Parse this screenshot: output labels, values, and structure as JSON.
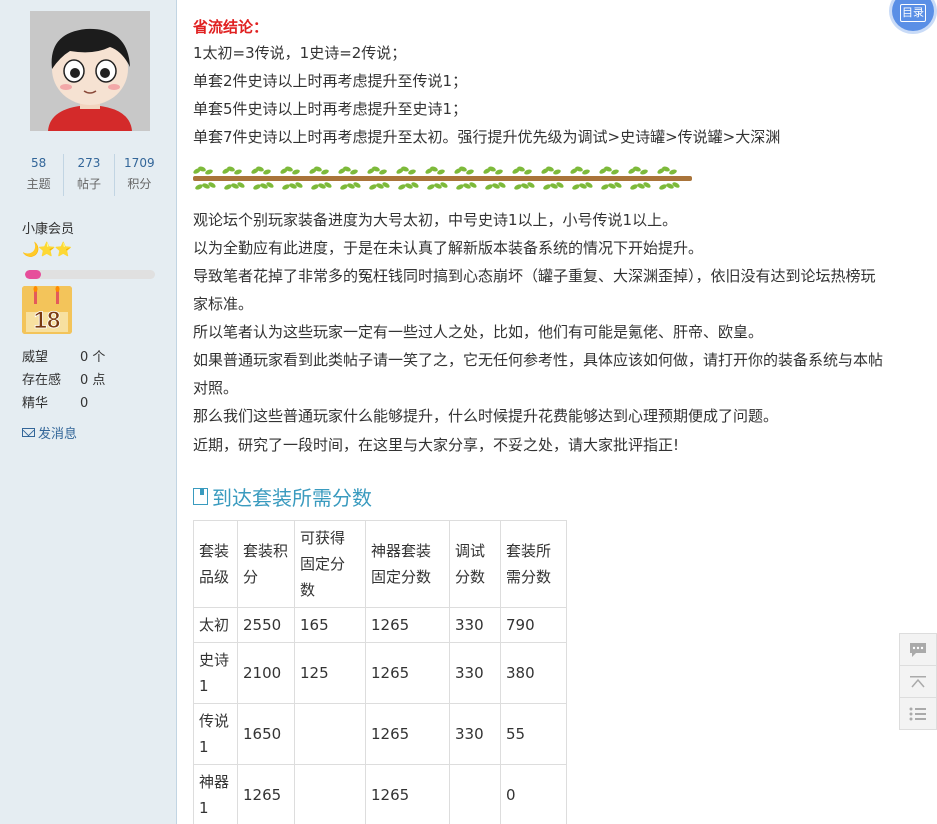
{
  "user": {
    "stats": [
      {
        "num": "58",
        "label": "主题"
      },
      {
        "num": "273",
        "label": "帖子"
      },
      {
        "num": "1709",
        "label": "积分"
      }
    ],
    "group": "小康会员",
    "stars": "🌙⭐⭐",
    "level_progress": 0.12,
    "medal_text": "18",
    "info": [
      {
        "key": "威望",
        "value": "0 个"
      },
      {
        "key": "存在感",
        "value": "0 点"
      },
      {
        "key": "精华",
        "value": "0"
      }
    ],
    "pm_label": "发消息"
  },
  "post": {
    "conclusion_title": "省流结论：",
    "conclusion_lines": [
      "1太初=3传说，1史诗=2传说；",
      "单套2件史诗以上时再考虑提升至传说1；",
      "单套5件史诗以上时再考虑提升至史诗1；",
      "单套7件史诗以上时再考虑提升至太初。强行提升优先级为调试>史诗罐>传说罐>大深渊"
    ],
    "body_lines": [
      "观论坛个别玩家装备进度为大号太初，中号史诗1以上，小号传说1以上。",
      "以为全勤应有此进度，于是在未认真了解新版本装备系统的情况下开始提升。",
      "导致笔者花掉了非常多的冤枉钱同时搞到心态崩坏（罐子重复、大深渊歪掉），依旧没有达到论坛热榜玩",
      "家标准。",
      "所以笔者认为这些玩家一定有一些过人之处，比如，他们有可能是氪佬、肝帝、欧皇。",
      "如果普通玩家看到此类帖子请一笑了之，它无任何参考性，具体应该如何做，请打开你的装备系统与本帖",
      "对照。",
      "那么我们这些普通玩家什么能够提升，什么时候提升花费能够达到心理预期便成了问题。",
      "近期，研究了一段时间，在这里与大家分享，不妥之处，请大家批评指正!"
    ],
    "section_title": "到达套装所需分数",
    "table": {
      "headers": [
        [
          "套装",
          "品级"
        ],
        [
          "套装积",
          "分"
        ],
        [
          "可获得",
          "固定分",
          "数"
        ],
        [
          "神器套装",
          "固定分数"
        ],
        [
          "调试",
          "分数"
        ],
        [
          "套装所",
          "需分数"
        ]
      ],
      "rows": [
        [
          [
            "太初"
          ],
          [
            "2550"
          ],
          [
            "165"
          ],
          [
            "1265"
          ],
          [
            "330"
          ],
          [
            "790"
          ]
        ],
        [
          [
            "史诗",
            "1"
          ],
          [
            "2100"
          ],
          [
            "125"
          ],
          [
            "1265"
          ],
          [
            "330"
          ],
          [
            "380"
          ]
        ],
        [
          [
            "传说",
            "1"
          ],
          [
            "1650"
          ],
          [
            ""
          ],
          [
            "1265"
          ],
          [
            "330"
          ],
          [
            "55"
          ]
        ],
        [
          [
            "神器",
            "1"
          ],
          [
            "1265"
          ],
          [
            ""
          ],
          [
            "1265"
          ],
          [
            ""
          ],
          [
            "0"
          ]
        ]
      ]
    }
  },
  "toc_label": "目录",
  "float_icons": [
    "comment-icon",
    "back-to-top-icon",
    "list-icon"
  ]
}
